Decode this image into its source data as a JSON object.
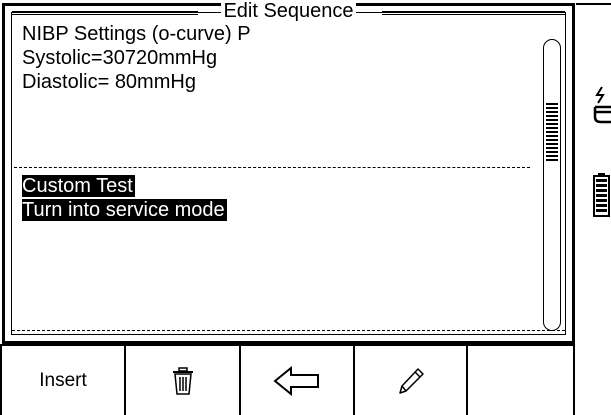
{
  "dialog": {
    "title": "Edit Sequence"
  },
  "content": {
    "lines": [
      "NIBP Settings (o-curve) P",
      "Systolic=30720mmHg",
      "Diastolic= 80mmHg"
    ],
    "selected_lines": [
      "Custom Test",
      "Turn into service mode"
    ]
  },
  "softkeys": [
    {
      "label": "Insert",
      "icon": ""
    },
    {
      "label": "",
      "icon": "trash-icon"
    },
    {
      "label": "",
      "icon": "back-arrow-icon"
    },
    {
      "label": "",
      "icon": "pencil-icon"
    },
    {
      "label": "",
      "icon": ""
    }
  ],
  "status": {
    "power_icon": "mains-plug-icon",
    "battery_icon": "battery-icon"
  }
}
